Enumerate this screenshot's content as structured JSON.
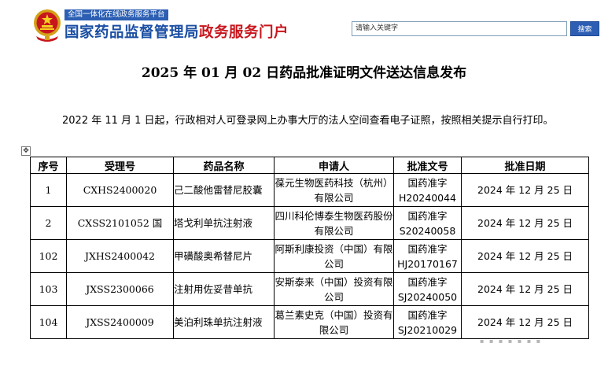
{
  "header": {
    "platform_badge": "全国一体化在线政务服务平台",
    "portal_title_main": "国家药品监督管理局",
    "portal_title_accent": "政务服务门户",
    "search_value": "请输入关键字",
    "search_button": "搜索",
    "colors": {
      "brand_blue": "#1a4ea3",
      "accent_red": "#c8161d",
      "badge_blue": "#2c5fb3"
    }
  },
  "article": {
    "title": "2025 年 01 月 02 日药品批准证明文件送达信息发布",
    "notice": "2022 年 11 月 1 日起，行政相对人可登录网上办事大厅的法人空间查看电子证照，按照相关提示自行打印。"
  },
  "table": {
    "headers": [
      "序号",
      "受理号",
      "药品名称",
      "申请人",
      "批准文号",
      "批准日期"
    ],
    "rows": [
      {
        "no": "1",
        "code": "CXHS2400020",
        "name": "己二酸他雷替尼胶囊",
        "applicant": "葆元生物医药科技（杭州）有限公司",
        "approval_no": "国药准字H20240044",
        "date": "2024 年 12 月 25 日"
      },
      {
        "no": "2",
        "code": "CXSS2101052 国",
        "name": "塔戈利单抗注射液",
        "applicant": "四川科伦博泰生物医药股份有限公司",
        "approval_no": "国药准字S20240058",
        "date": "2024 年 12 月 25 日"
      },
      {
        "no": "102",
        "code": "JXHS2400042",
        "name": "甲磺酸奥希替尼片",
        "applicant": "阿斯利康投资（中国）有限公司",
        "approval_no": "国药准字HJ20170167",
        "date": "2024 年 12 月 25 日"
      },
      {
        "no": "103",
        "code": "JXSS2300066",
        "name": "注射用佐妥昔单抗",
        "applicant": "安斯泰来（中国）投资有限公司",
        "approval_no": "国药准字SJ20240050",
        "date": "2024 年 12 月 25 日"
      },
      {
        "no": "104",
        "code": "JXSS2400009",
        "name": "美泊利珠单抗注射液",
        "applicant": "葛兰素史克（中国）投资有限公司",
        "approval_no": "国药准字SJ20210029",
        "date": "2024 年 12 月 25 日"
      }
    ]
  }
}
